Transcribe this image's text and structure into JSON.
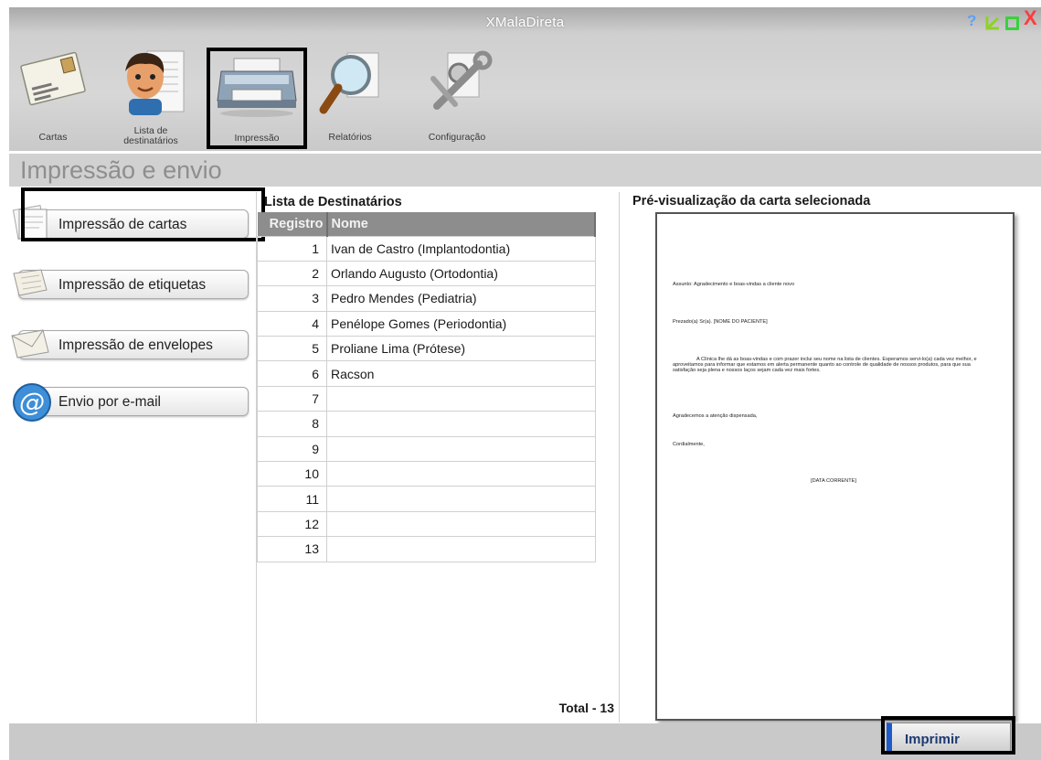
{
  "window": {
    "title": "XMalaDireta",
    "controls": {
      "help": "?",
      "close": "X"
    }
  },
  "toolbar": {
    "items": [
      {
        "label": "Cartas",
        "icon": "letter-icon"
      },
      {
        "label": "Lista de destinatários",
        "icon": "person-list-icon"
      },
      {
        "label": "Impressão",
        "icon": "printer-icon",
        "selected": true
      },
      {
        "label": "Relatórios",
        "icon": "magnifier-icon"
      },
      {
        "label": "Configuração",
        "icon": "tools-icon"
      }
    ]
  },
  "page": {
    "title": "Impressão e envio"
  },
  "actions": [
    {
      "label": "Impressão de cartas",
      "icon": "letter-stack-icon",
      "highlighted": true
    },
    {
      "label": "Impressão de etiquetas",
      "icon": "label-icon"
    },
    {
      "label": "Impressão de envelopes",
      "icon": "envelope-icon"
    },
    {
      "label": "Envio por e-mail",
      "icon": "at-sign-icon"
    }
  ],
  "recipients": {
    "title": "Lista de Destinatários",
    "columns": [
      "Registro",
      "Nome"
    ],
    "rows": [
      [
        "1",
        "Ivan de Castro (Implantodontia)"
      ],
      [
        "2",
        "Orlando Augusto (Ortodontia)"
      ],
      [
        "3",
        "Pedro Mendes (Pediatria)"
      ],
      [
        "4",
        "Penélope Gomes (Periodontia)"
      ],
      [
        "5",
        "Proliane Lima (Prótese)"
      ],
      [
        "6",
        "Racson"
      ],
      [
        "7",
        ""
      ],
      [
        "8",
        ""
      ],
      [
        "9",
        ""
      ],
      [
        "10",
        ""
      ],
      [
        "11",
        ""
      ],
      [
        "12",
        ""
      ],
      [
        "13",
        ""
      ]
    ],
    "total": "Total - 13"
  },
  "preview": {
    "title": "Pré-visualização da carta selecionada",
    "assunto": "Assunto: Agradecimento e boas-vindas a cliente novo",
    "prezado": "Prezado(a) Sr(a). [NOME DO PACIENTE]",
    "body": "A Clínica lhe dá as boas-vindas e com prazer inclui seu nome na lista de clientes. Esperamos servi-lo(a) cada vez melhor, e aproveitamos para informar que estamos em alerta permanente quanto ao controle de qualidade de nossos produtos, para que sua satisfação seja plena e nossos laços sejam cada vez mais fortes.",
    "agradecemos": "Agradecemos a atenção dispensada,",
    "cordialmente": "Cordialmente,",
    "data": "[DATA CORRENTE]"
  },
  "footer": {
    "print_label": "Imprimir"
  },
  "colors": {
    "accent": "#1e5bc8",
    "table_header": "#8d8d8d",
    "close": "#ff3b3b",
    "maximize": "#39d13b",
    "help": "#5aa0ff"
  }
}
